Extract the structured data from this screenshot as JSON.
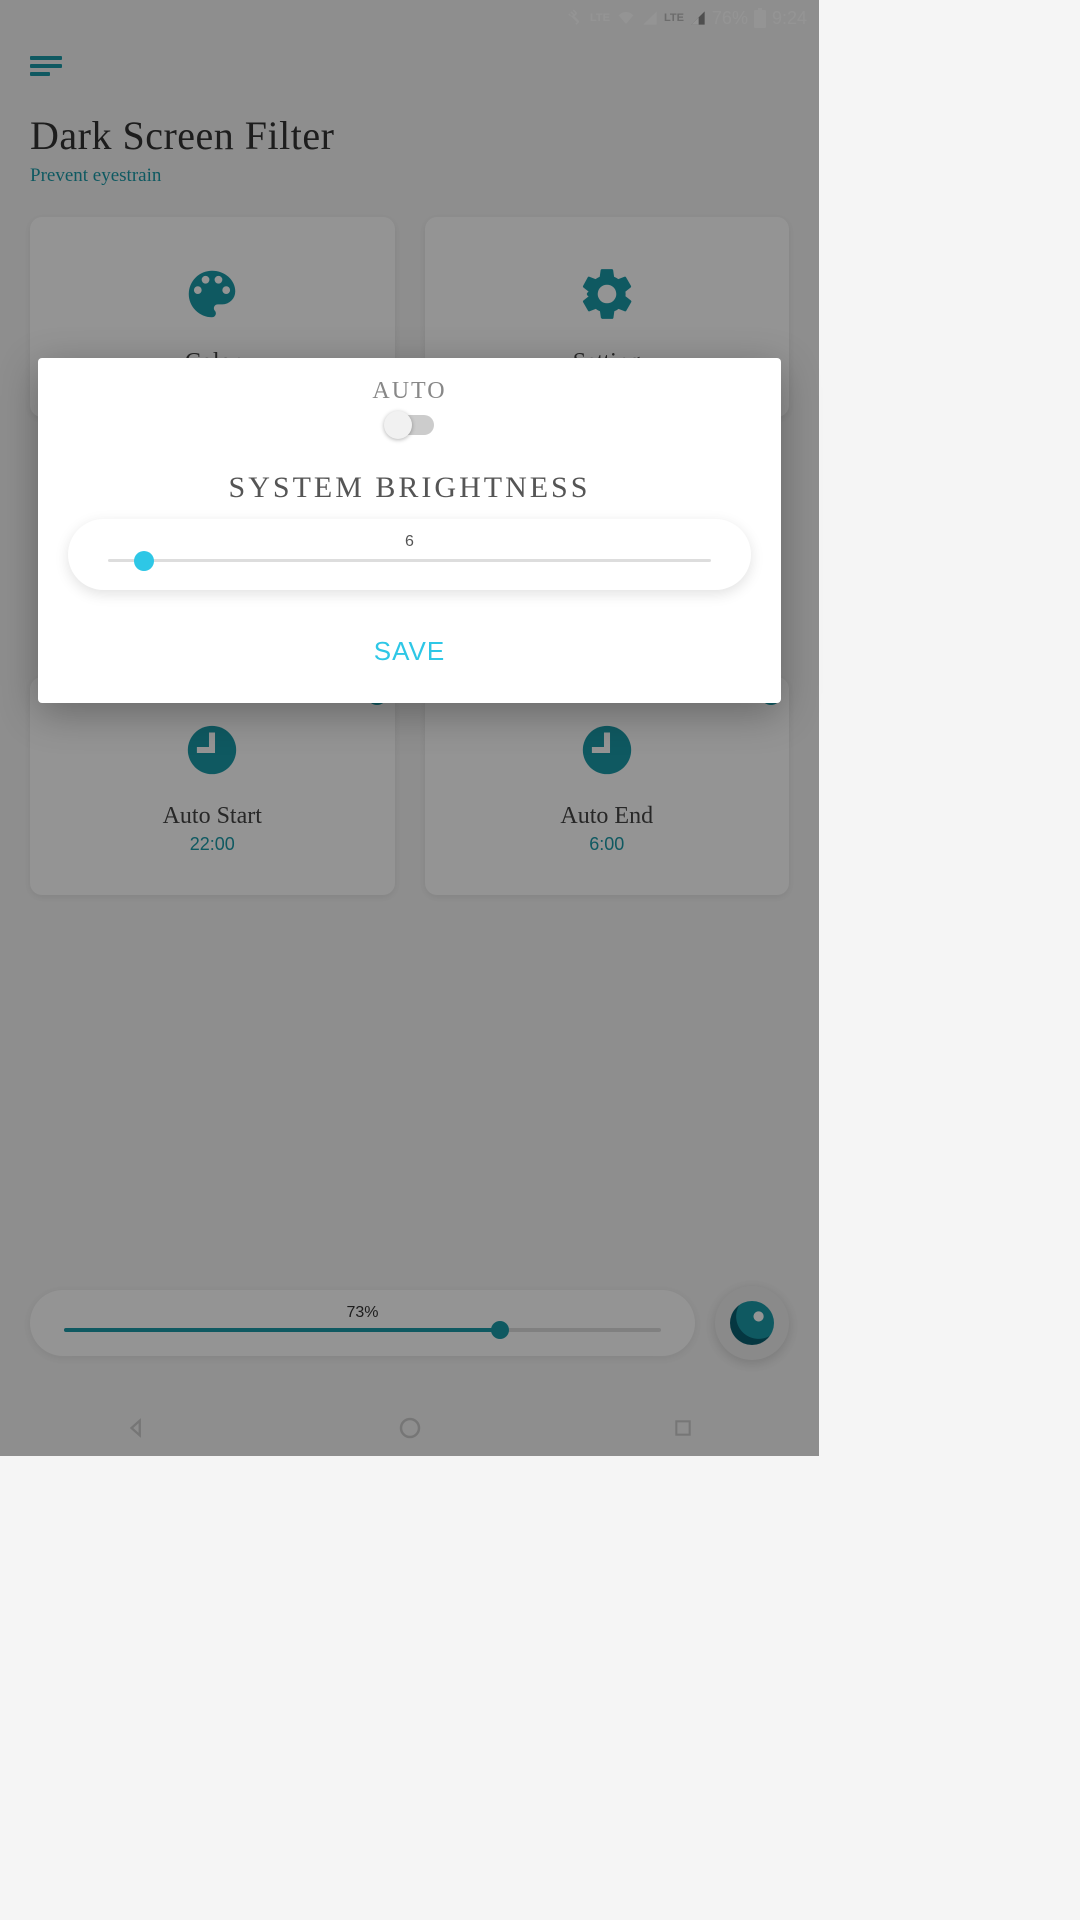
{
  "status": {
    "lte1": "LTE",
    "lte2": "LTE",
    "battery_pct": "76%",
    "time": "9:24"
  },
  "header": {
    "title": "Dark Screen Filter",
    "subtitle": "Prevent eyestrain"
  },
  "cards": {
    "color": {
      "label": "Color"
    },
    "setting": {
      "label": "Setting"
    },
    "auto_start": {
      "label": "Auto Start",
      "value": "22:00"
    },
    "auto_end": {
      "label": "Auto End",
      "value": "6:00"
    }
  },
  "bottom": {
    "pct_label": "73%",
    "pct_value": 73
  },
  "dialog": {
    "auto_label": "AUTO",
    "auto_on": false,
    "heading": "SYSTEM BRIGHTNESS",
    "slider_value_label": "6",
    "slider_value": 6,
    "save_label": "SAVE"
  },
  "colors": {
    "accent": "#1a9aa8",
    "accent_light": "#2ec7e6"
  }
}
